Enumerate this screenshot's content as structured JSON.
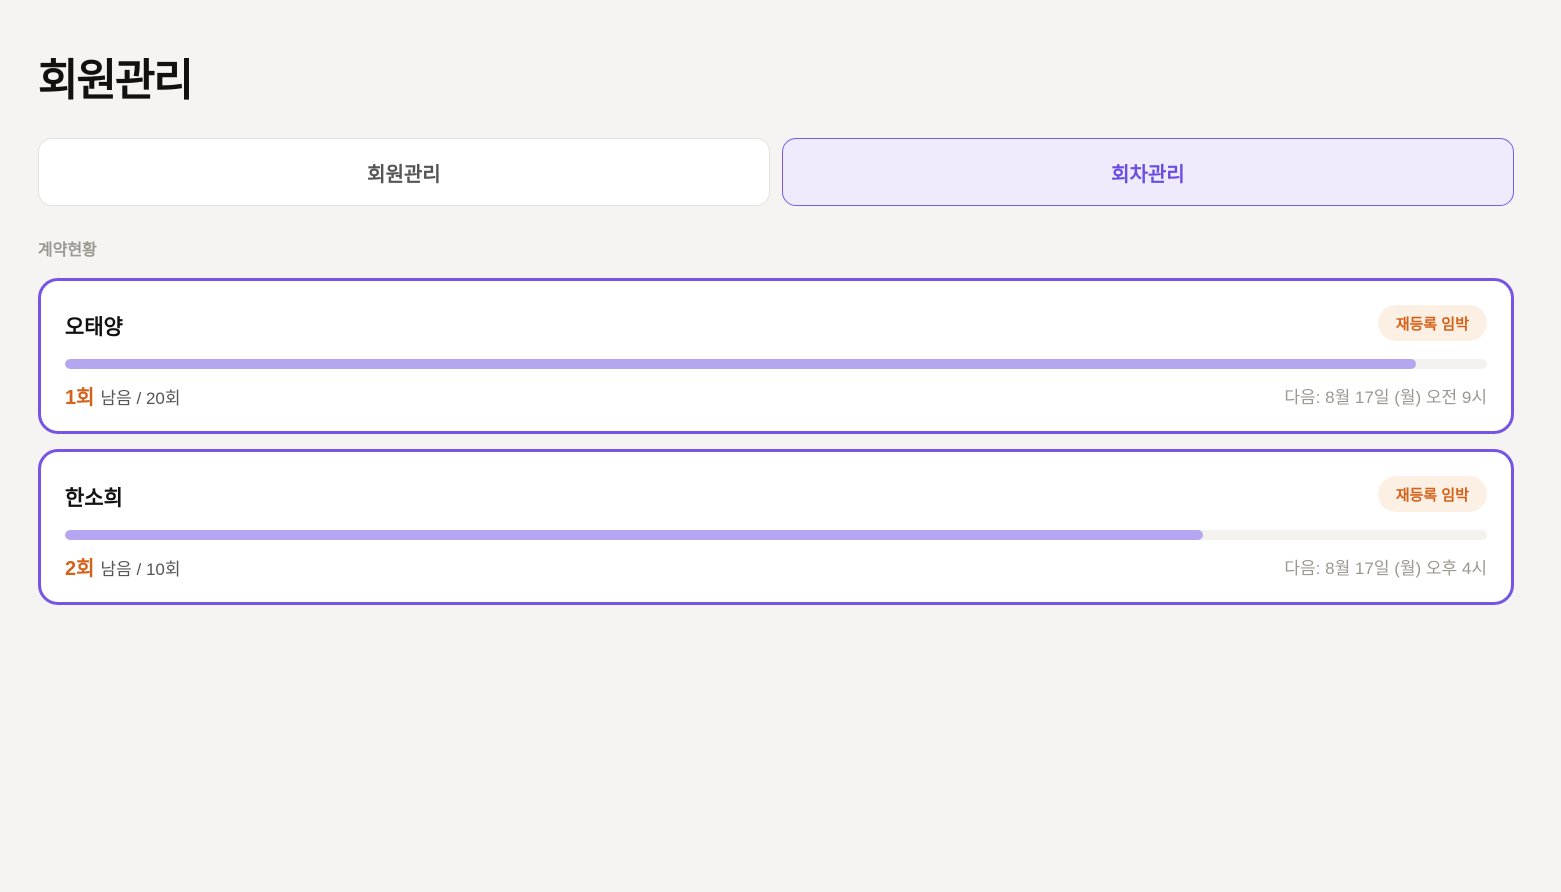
{
  "page": {
    "title": "회원관리"
  },
  "tabs": [
    {
      "label": "회원관리",
      "active": false
    },
    {
      "label": "회차관리",
      "active": true
    }
  ],
  "section": {
    "label": "계약현황"
  },
  "colors": {
    "accent": "#7654e6",
    "warning": "#d4621a",
    "progress": "#b6a6f2"
  },
  "members": [
    {
      "name": "오태양",
      "badge": "재등록 임박",
      "remaining_count": "1회",
      "remaining_suffix": "남음 / 20회",
      "used_fraction": 0.95,
      "next": "다음: 8월 17일 (월) 오전 9시"
    },
    {
      "name": "한소희",
      "badge": "재등록 임박",
      "remaining_count": "2회",
      "remaining_suffix": "남음 / 10회",
      "used_fraction": 0.8,
      "next": "다음: 8월 17일 (월) 오후 4시"
    }
  ]
}
